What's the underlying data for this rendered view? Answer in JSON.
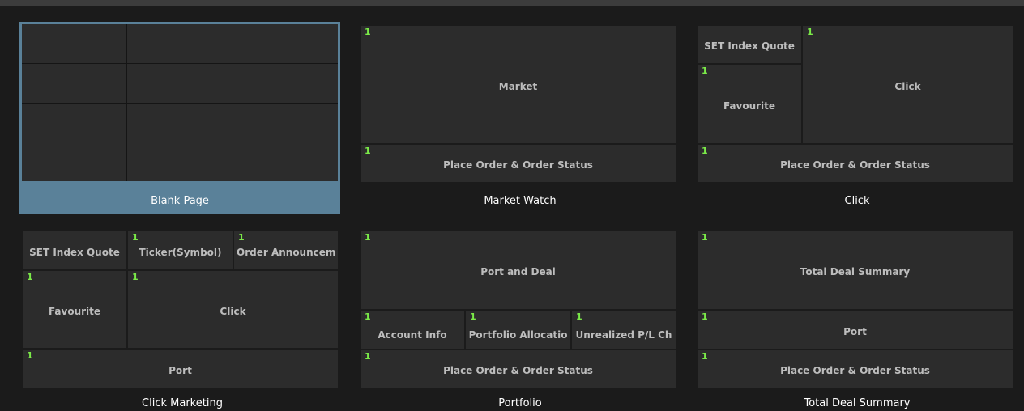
{
  "layouts": {
    "blank": {
      "caption": "Blank Page"
    },
    "market_watch": {
      "caption": "Market Watch",
      "panes": [
        {
          "num": "1",
          "label": "Market"
        },
        {
          "num": "1",
          "label": "Place Order & Order Status"
        }
      ]
    },
    "click": {
      "caption": "Click",
      "panes": [
        {
          "num": "",
          "label": "SET Index Quote"
        },
        {
          "num": "1",
          "label": "Favourite"
        },
        {
          "num": "1",
          "label": "Click"
        },
        {
          "num": "1",
          "label": "Place Order & Order Status"
        }
      ]
    },
    "click_marketing": {
      "caption": "Click Marketing",
      "panes": [
        {
          "num": "",
          "label": "SET Index Quote"
        },
        {
          "num": "1",
          "label": "Ticker(Symbol)"
        },
        {
          "num": "1",
          "label": "Order Announcem"
        },
        {
          "num": "1",
          "label": "Favourite"
        },
        {
          "num": "1",
          "label": "Click"
        },
        {
          "num": "1",
          "label": "Port"
        }
      ]
    },
    "portfolio": {
      "caption": "Portfolio",
      "panes": [
        {
          "num": "1",
          "label": "Port and Deal"
        },
        {
          "num": "1",
          "label": "Account Info"
        },
        {
          "num": "1",
          "label": "Portfolio Allocatio"
        },
        {
          "num": "1",
          "label": "Unrealized P/L Ch"
        },
        {
          "num": "1",
          "label": "Place Order & Order Status"
        }
      ]
    },
    "total_deal": {
      "caption": "Total Deal Summary",
      "panes": [
        {
          "num": "1",
          "label": "Total Deal Summary"
        },
        {
          "num": "1",
          "label": "Port"
        },
        {
          "num": "1",
          "label": "Place Order & Order Status"
        }
      ]
    }
  },
  "colors": {
    "background": "#1b1b1b",
    "pane": "#2c2c2c",
    "selected": "#5a8199",
    "pane_number": "#7bea48"
  }
}
